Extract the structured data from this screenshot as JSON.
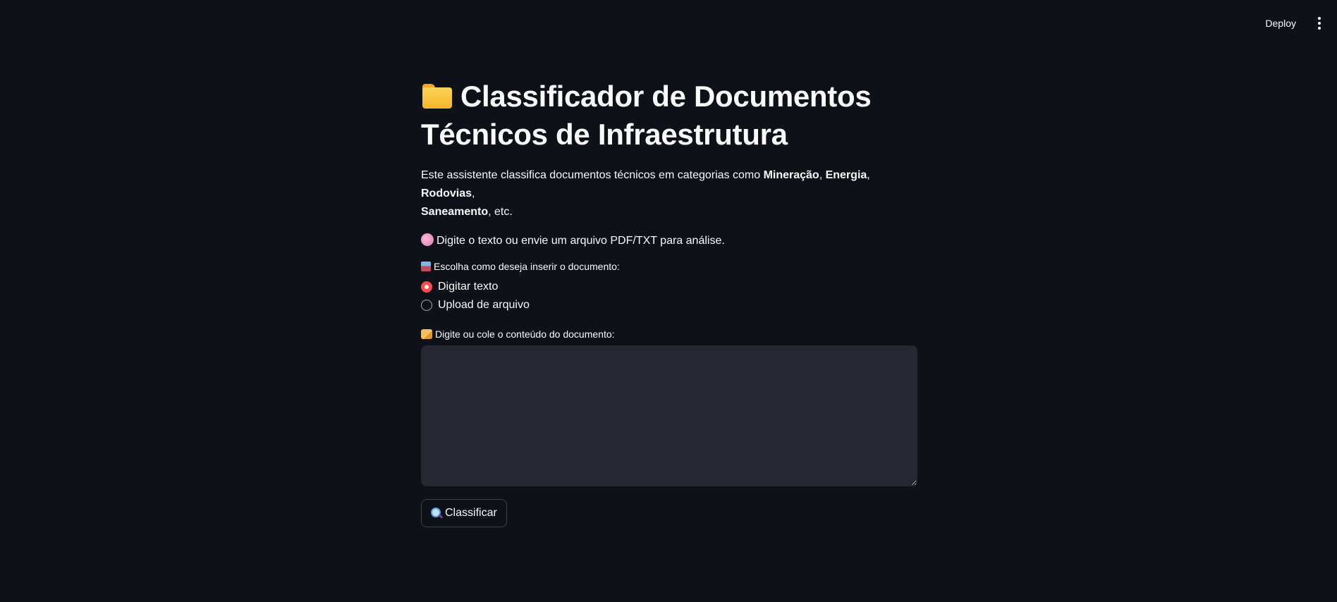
{
  "topbar": {
    "deploy_label": "Deploy",
    "menu_icon": "vertical-ellipsis-icon"
  },
  "main": {
    "title_icon": "folder-icon",
    "title_line1": "Classificador de Documentos",
    "title_line2": "Técnicos de Infraestrutura",
    "intro": {
      "prefix": "Este assistente classifica documentos técnicos em categorias como ",
      "cat1": "Mineração",
      "sep1": ", ",
      "cat2": "Energia",
      "sep2": ", ",
      "cat3": "Rodovias",
      "sep3": ",",
      "cat4": "Saneamento",
      "suffix": ", etc."
    },
    "hint_icon": "brain-icon",
    "hint_text": "Digite o texto ou envie um arquivo PDF/TXT para análise.",
    "radio": {
      "icon": "inbox-tray-icon",
      "label": "Escolha como deseja inserir o documento:",
      "options": [
        "Digitar texto",
        "Upload de arquivo"
      ],
      "selected": "Digitar texto"
    },
    "textarea": {
      "icon": "writing-hand-icon",
      "label": "Digite ou cole o conteúdo do documento:",
      "value": ""
    },
    "classify_button": {
      "icon": "magnifying-glass-icon",
      "label": "Classificar"
    }
  },
  "colors": {
    "background": "#0e1117",
    "text": "#fafafa",
    "accent": "#ff4b4b",
    "input_bg": "#262730"
  }
}
